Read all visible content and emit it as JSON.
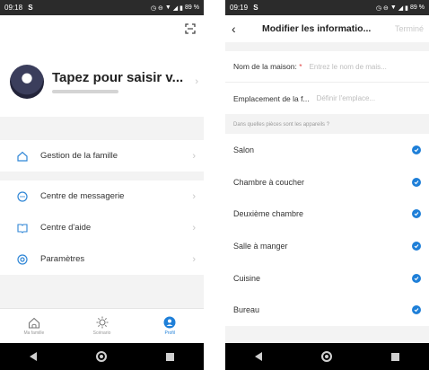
{
  "left": {
    "status_time": "09:18",
    "status_s": "S",
    "status_battery": "89 %",
    "profile_name": "Tapez pour saisir v...",
    "menu": [
      {
        "label": "Gestion de la famille",
        "icon": "home-outline-icon"
      },
      {
        "label": "Centre de messagerie",
        "icon": "chat-bubble-icon"
      },
      {
        "label": "Centre d'aide",
        "icon": "book-icon"
      },
      {
        "label": "Paramètres",
        "icon": "settings-icon"
      }
    ],
    "tabs": [
      {
        "label": "Ma famille",
        "icon": "home-icon"
      },
      {
        "label": "Scénario",
        "icon": "sun-icon"
      },
      {
        "label": "Profil",
        "icon": "profile-icon"
      }
    ]
  },
  "right": {
    "status_time": "09:19",
    "status_s": "S",
    "status_battery": "89 %",
    "title": "Modifier les informatio...",
    "done_label": "Terminé",
    "name_label": "Nom de la maison:",
    "name_required": "*",
    "name_placeholder": "Entrez le nom de mais...",
    "location_label": "Emplacement de la f...",
    "location_placeholder": "Définir l'emplace...",
    "rooms_caption": "Dans quelles pièces sont les appareils ?",
    "rooms": [
      "Salon",
      "Chambre à coucher",
      "Deuxième chambre",
      "Salle à manger",
      "Cuisine",
      "Bureau"
    ]
  },
  "colors": {
    "accent": "#1e7fd8",
    "required": "#e04545"
  }
}
